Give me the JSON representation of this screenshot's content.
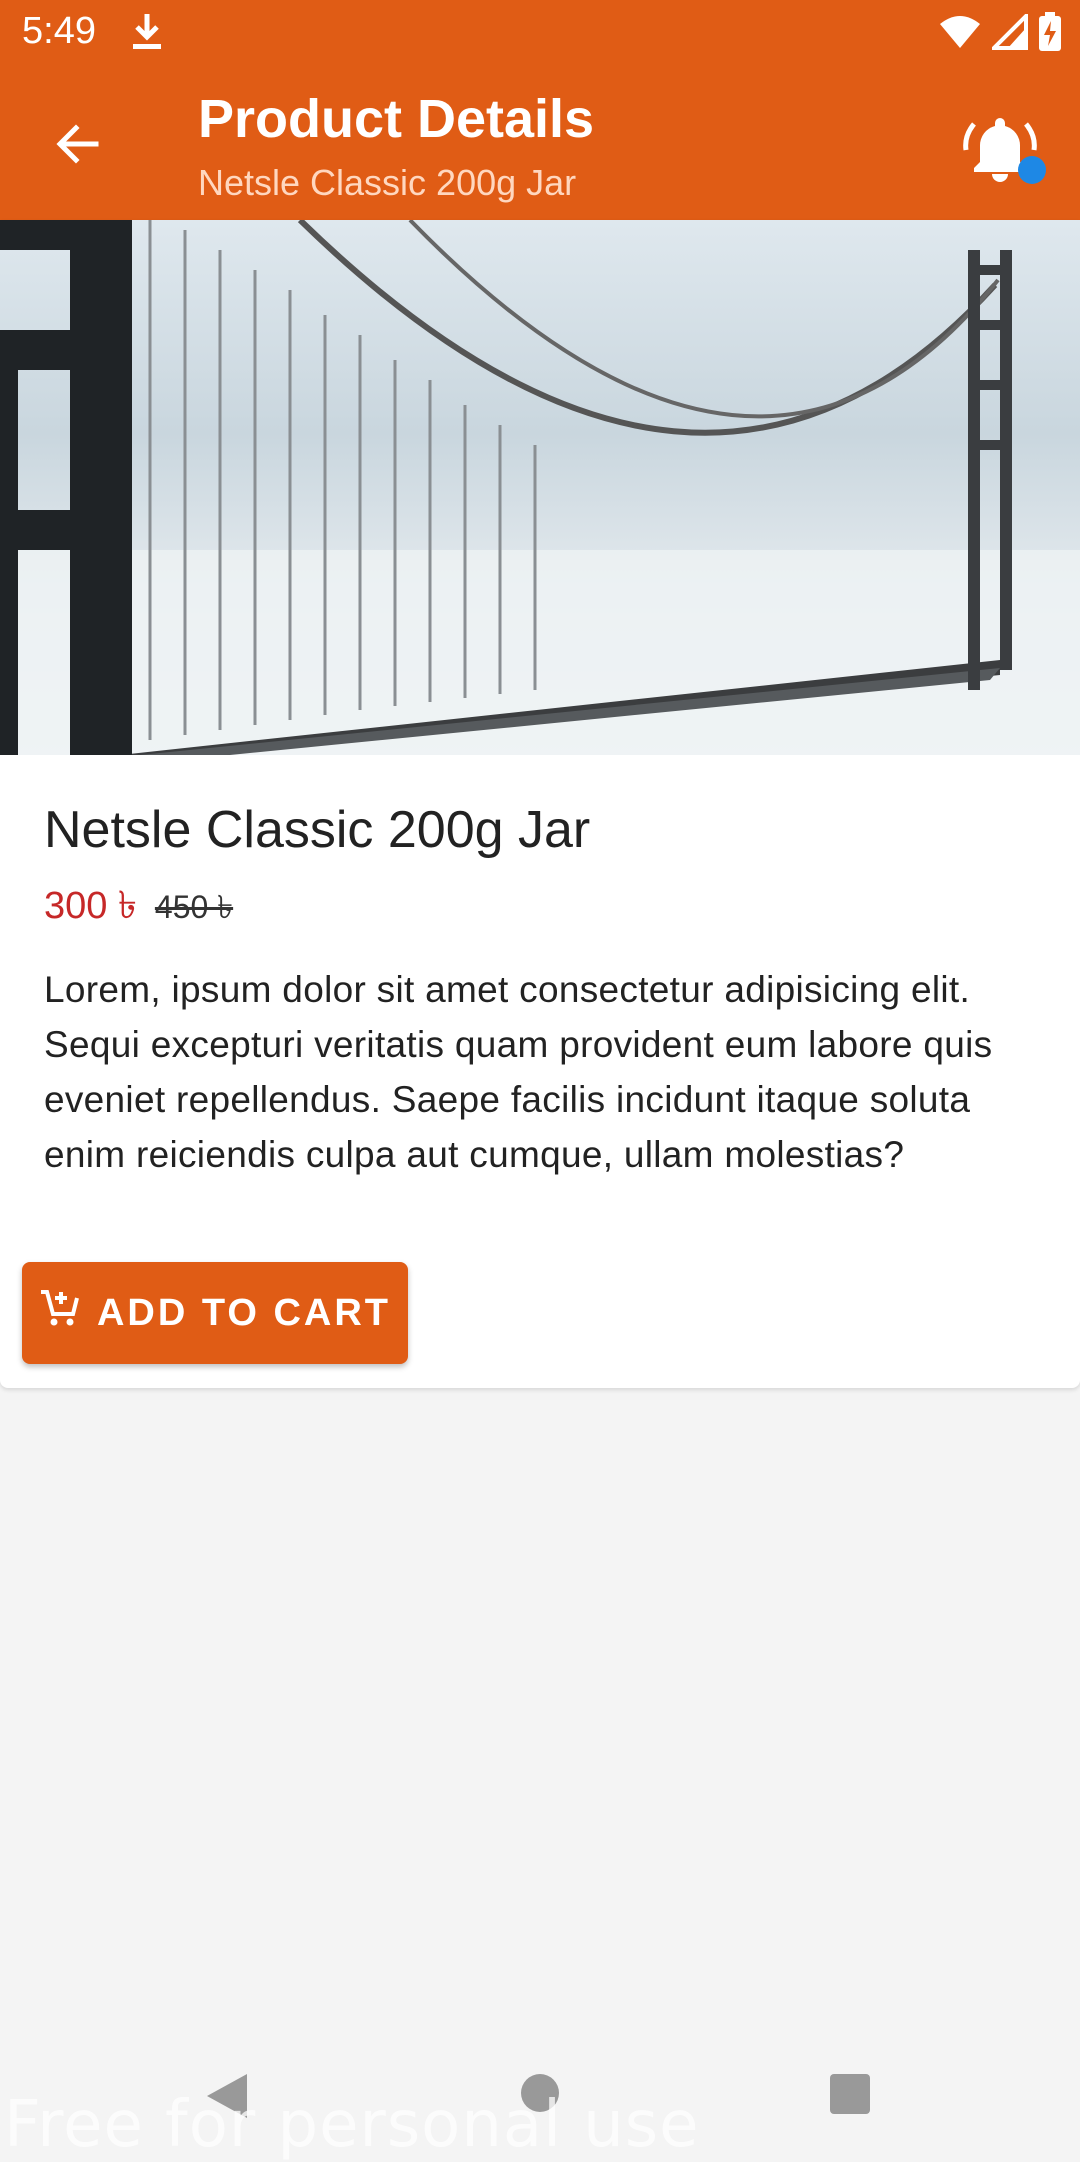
{
  "status_bar": {
    "time": "5:49",
    "download_icon": "download-icon",
    "wifi_icon": "wifi-icon",
    "signal_icon": "signal-icon",
    "battery_icon": "battery-charging-icon"
  },
  "app_bar": {
    "title": "Product Details",
    "subtitle": "Netsle Classic 200g Jar",
    "back_icon": "arrow-back-icon",
    "bell_icon": "bell-ringing-icon",
    "accent_color": "#E05C15"
  },
  "product": {
    "image_alt": "bridge-photo",
    "name": "Netsle Classic 200g Jar",
    "price": "300 ৳",
    "old_price": "450 ৳",
    "description": "Lorem, ipsum dolor sit amet consectetur adipisicing elit. Sequi excepturi veritatis quam provident eum labore quis eveniet repellendus. Saepe facilis incidunt itaque soluta enim reiciendis culpa aut cumque, ullam molestias?",
    "price_color": "#c62828"
  },
  "actions": {
    "add_to_cart_label": "ADD TO CART",
    "cart_icon": "add-cart-icon"
  },
  "nav_bar": {
    "back": "nav-back-icon",
    "home": "nav-home-icon",
    "recents": "nav-recents-icon"
  },
  "watermark": "Free for personal use"
}
